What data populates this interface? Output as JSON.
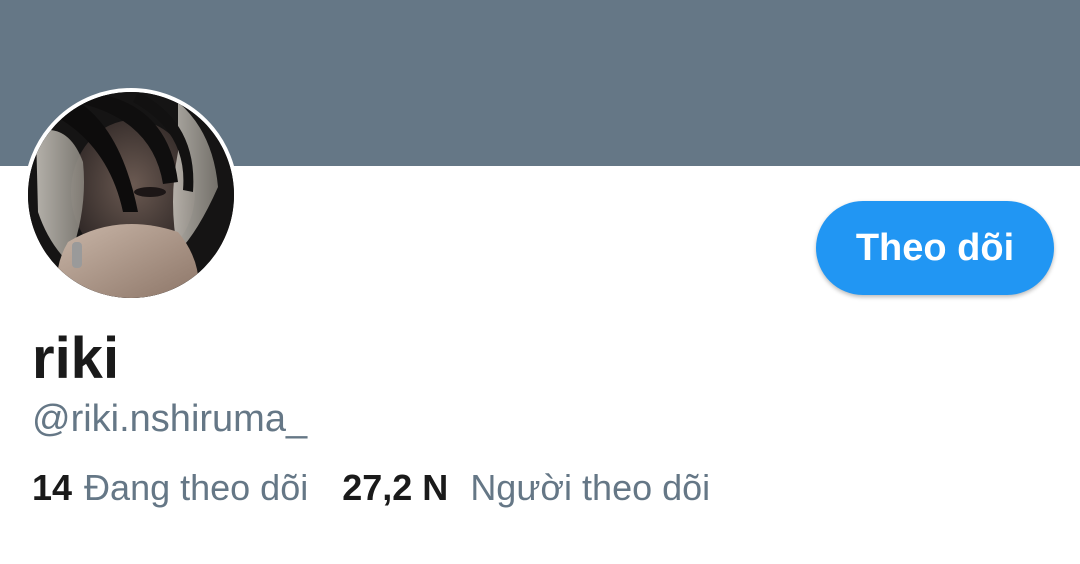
{
  "profile": {
    "display_name": "riki",
    "handle": "@riki.nshiruma_",
    "follow_button_label": "Theo dõi"
  },
  "stats": {
    "following_count": "14",
    "following_label": "Đang theo dõi",
    "followers_count": "27,2 N",
    "followers_label": "Người theo dõi"
  },
  "colors": {
    "banner": "#657786",
    "accent": "#2196f3",
    "secondary_text": "#657786",
    "primary_text": "#1a1a1a"
  }
}
